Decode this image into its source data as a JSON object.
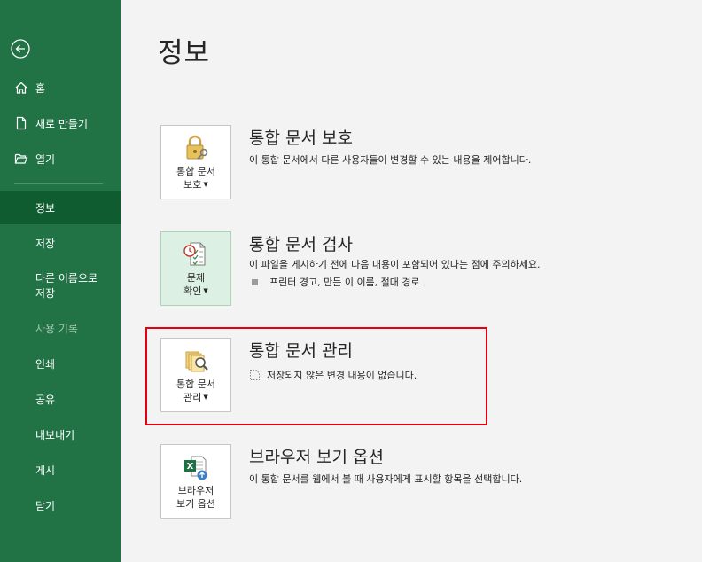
{
  "sidebar": {
    "items": [
      {
        "label": "홈"
      },
      {
        "label": "새로 만들기"
      },
      {
        "label": "열기"
      },
      {
        "label": "정보"
      },
      {
        "label": "저장"
      },
      {
        "label": "다른 이름으로\n저장"
      },
      {
        "label": "사용 기록"
      },
      {
        "label": "인쇄"
      },
      {
        "label": "공유"
      },
      {
        "label": "내보내기"
      },
      {
        "label": "게시"
      },
      {
        "label": "닫기"
      }
    ]
  },
  "page": {
    "title": "정보"
  },
  "sections": {
    "protect": {
      "tile_line1": "통합 문서",
      "tile_line2": "보호",
      "heading": "통합 문서 보호",
      "description": "이 통합 문서에서 다른 사용자들이 변경할 수 있는 내용을 제어합니다."
    },
    "inspect": {
      "tile_line1": "문제",
      "tile_line2": "확인",
      "heading": "통합 문서 검사",
      "description": "이 파일을 게시하기 전에 다음 내용이 포함되어 있다는 점에 주의하세요.",
      "bullet": "프린터 경고, 만든 이 이름, 절대 경로"
    },
    "manage": {
      "tile_line1": "통합 문서",
      "tile_line2": "관리",
      "heading": "통합 문서 관리",
      "note": "저장되지 않은 변경 내용이 없습니다."
    },
    "browser": {
      "tile_line1": "브라우저",
      "tile_line2": "보기 옵션",
      "heading": "브라우저 보기 옵션",
      "description": "이 통합 문서를 웹에서 볼 때 사용자에게 표시할 항목을 선택합니다."
    }
  },
  "colors": {
    "sidebar_bg": "#217346",
    "sidebar_active": "#0e5c2f",
    "highlight": "#e3000f"
  }
}
